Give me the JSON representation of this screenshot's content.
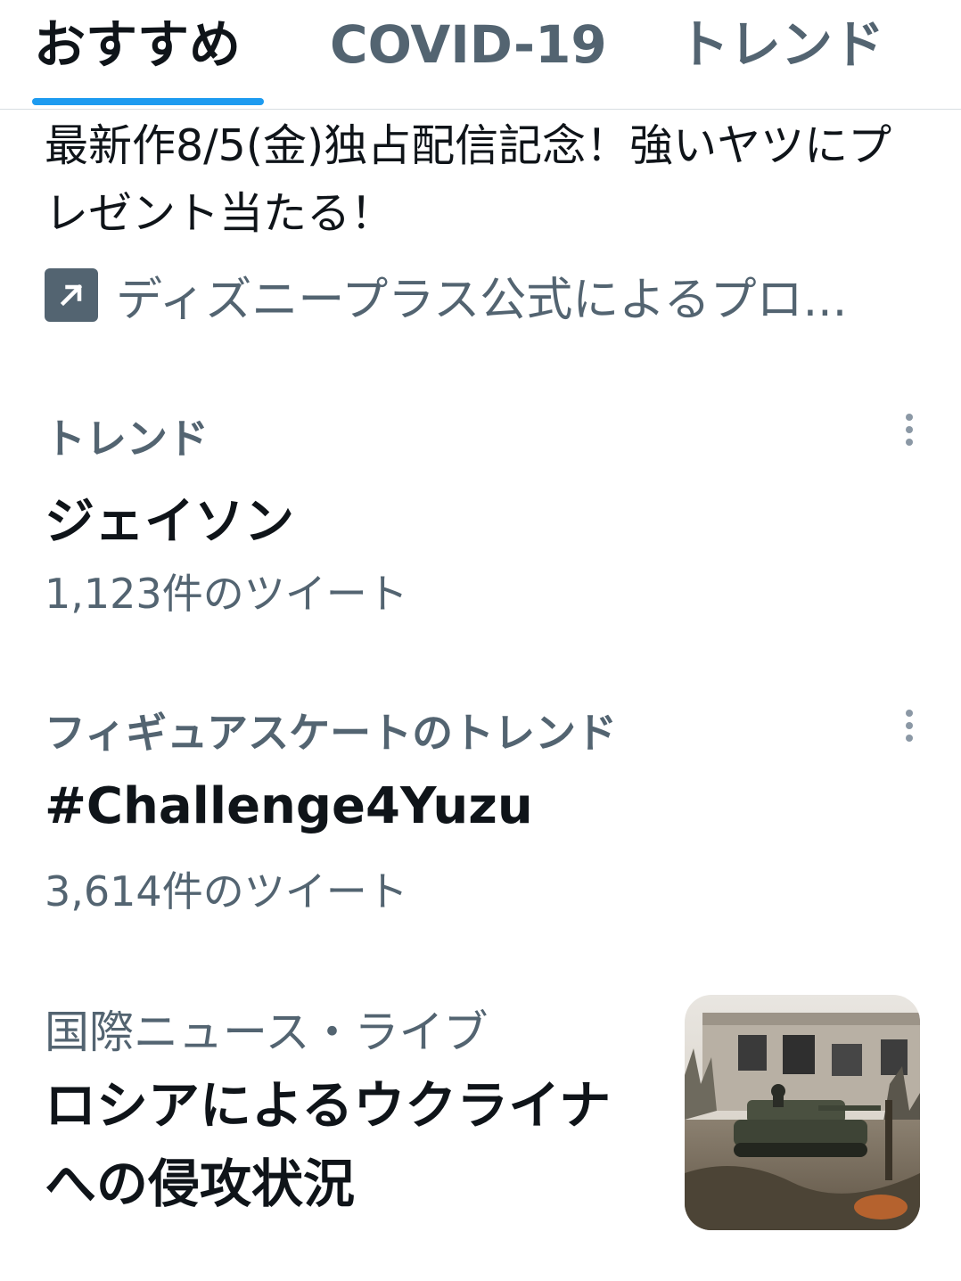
{
  "tabs": [
    {
      "label": "おすすめ",
      "active": true
    },
    {
      "label": "COVID-19",
      "active": false
    },
    {
      "label": "トレンド",
      "active": false
    }
  ],
  "accent_color": "#1d9bf0",
  "promo": {
    "text": "最新作8/5(金)独占配信記念！強いヤツにプレゼント当たる！",
    "icon": "external-link-arrow-icon",
    "sponsor_label": "ディズニープラス公式によるプロ..."
  },
  "trends": [
    {
      "category": "トレンド",
      "name": "ジェイソン",
      "count": "1,123件のツイート"
    },
    {
      "category": "フィギュアスケートのトレンド",
      "name": "#Challenge4Yuzu",
      "count": "3,614件のツイート"
    }
  ],
  "news": {
    "category": "国際ニュース・ライブ",
    "title": "ロシアによるウクライナへの侵攻状況",
    "thumbnail": "tank-photo-thumbnail"
  }
}
